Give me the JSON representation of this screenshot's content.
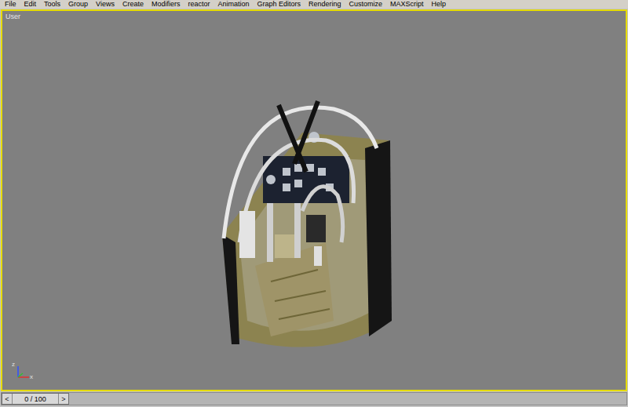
{
  "menu": [
    "File",
    "Edit",
    "Tools",
    "Group",
    "Views",
    "Create",
    "Modifiers",
    "reactor",
    "Animation",
    "Graph Editors",
    "Rendering",
    "Customize",
    "MAXScript",
    "Help"
  ],
  "viewport": {
    "label": "User",
    "active": true
  },
  "axis": {
    "z": "z",
    "x": "x"
  },
  "time_slider": {
    "prev": "<",
    "reading": "0 / 100",
    "next": ">",
    "level": 0
  }
}
